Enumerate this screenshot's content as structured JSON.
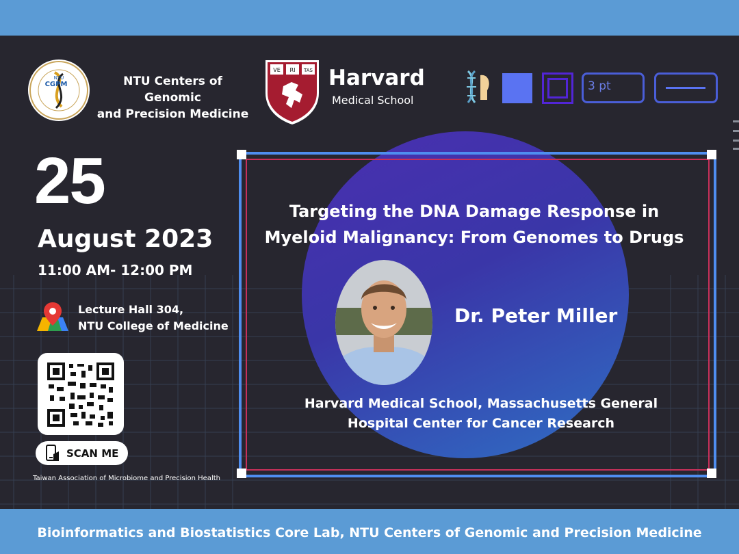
{
  "header": {
    "ntu_name_line1": "NTU Centers of Genomic",
    "ntu_name_line2": "and Precision Medicine",
    "ntu_logo_text": "CGPM",
    "ntu_logo_small": "NTU",
    "hms_title": "Harvard",
    "hms_subtitle": "Medical School",
    "hms_shield_text": [
      "VE",
      "RI",
      "TAS"
    ]
  },
  "toolbar": {
    "point_size_label": "3 pt",
    "icons": [
      "dna-icon",
      "filled-square-icon",
      "outline-square-icon",
      "line-weight-icon"
    ]
  },
  "event": {
    "day": "25",
    "month_year": "August 2023",
    "time": "11:00 AM- 12:00 PM",
    "venue_line1": "Lecture Hall 304,",
    "venue_line2": "NTU College of Medicine",
    "scan_label": "SCAN ME",
    "organizer": "Taiwan Association of Microbiome and Precision Health"
  },
  "talk": {
    "title_line1": "Targeting the DNA Damage Response in",
    "title_line2": "Myeloid Malignancy: From Genomes to Drugs",
    "speaker": "Dr. Peter Miller",
    "affiliation_line1": "Harvard Medical School, Massachusetts General",
    "affiliation_line2": "Hospital Center for Cancer Research"
  },
  "footer": {
    "text": "Bioinformatics and Biostatistics Core Lab, NTU Centers of Genomic and Precision Medicine"
  },
  "colors": {
    "background": "#27262f",
    "bar_blue": "#5b9bd5",
    "frame_blue": "#4f8ef0",
    "frame_red": "#c8305a",
    "circle_purple": "#4a2fb0",
    "circle_blue": "#2f6fc4"
  }
}
